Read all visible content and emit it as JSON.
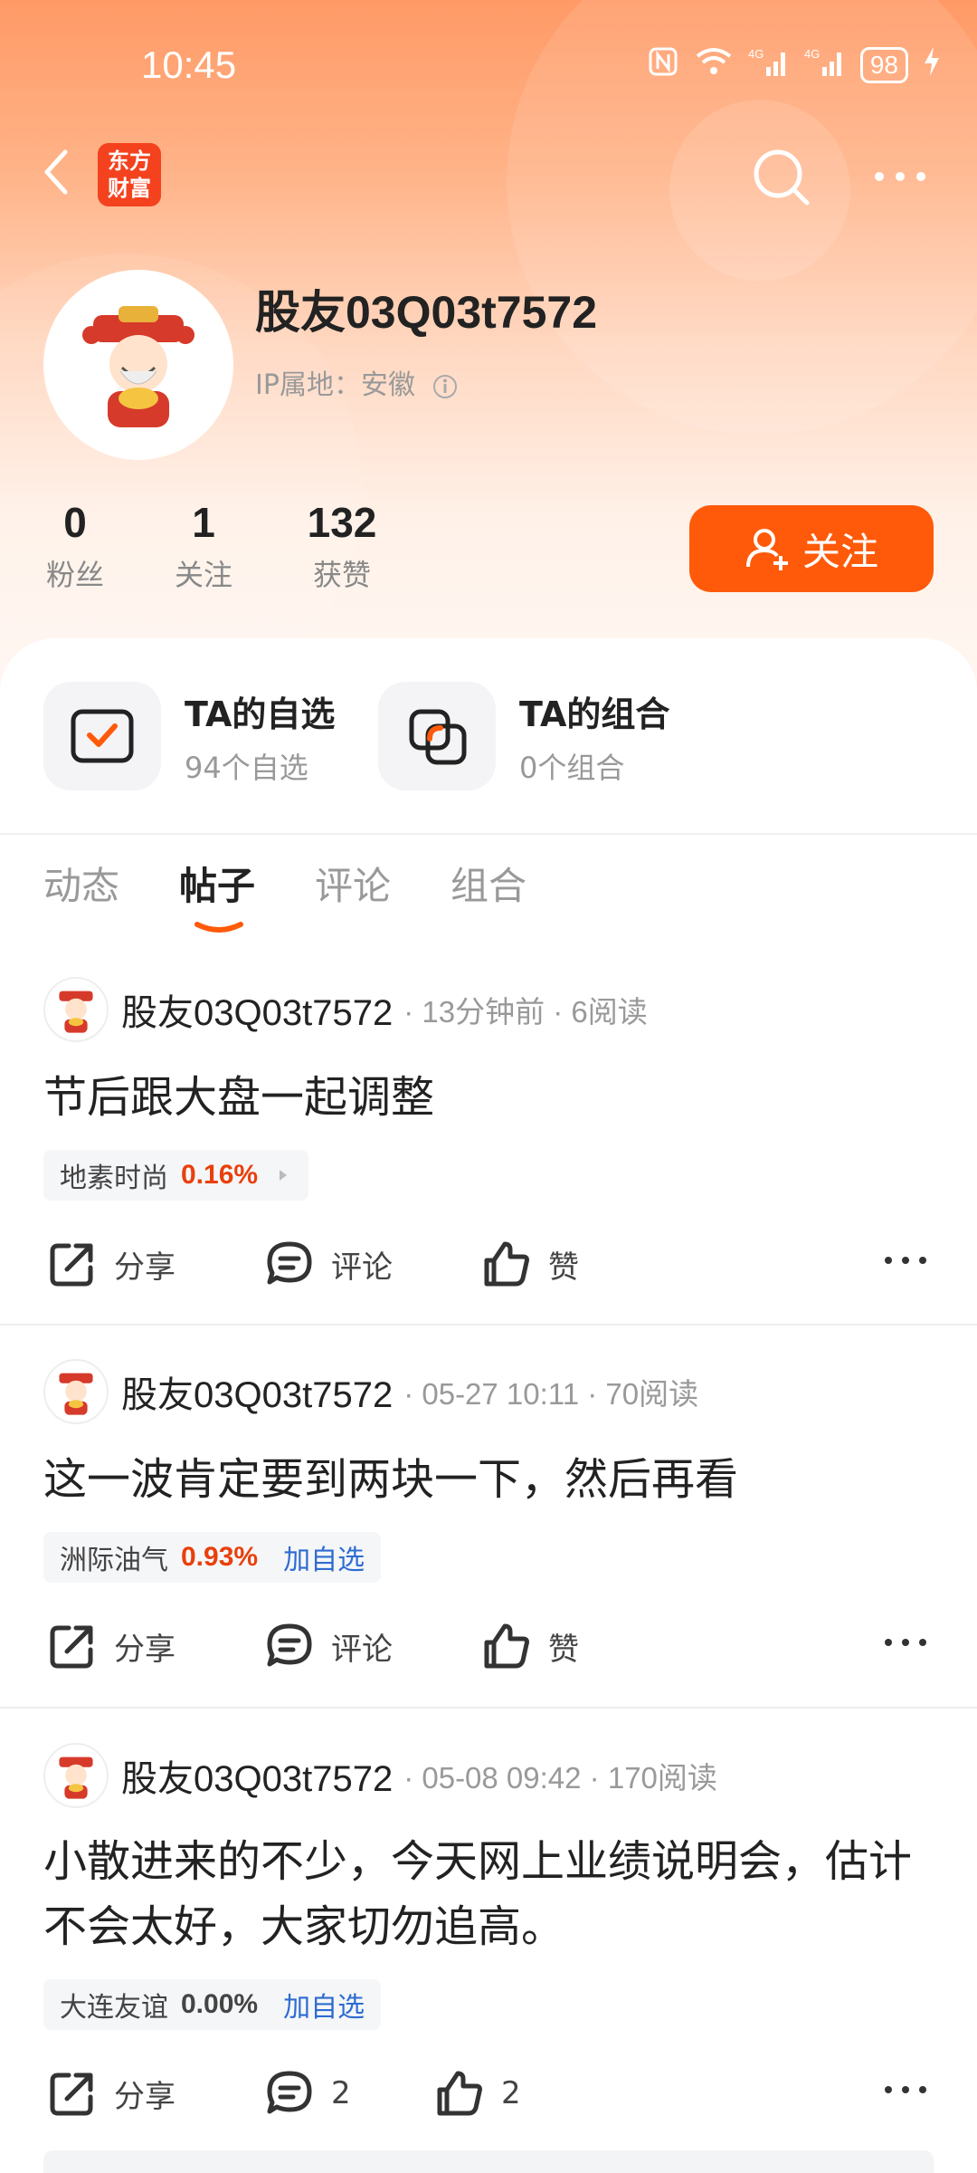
{
  "status_bar": {
    "time": "10:45",
    "network1": "4G",
    "network2": "4G",
    "battery": "98"
  },
  "top_nav": {
    "logo_line1": "东方",
    "logo_line2": "财富"
  },
  "profile": {
    "username": "股友03Q03t7572",
    "ip_label": "IP属地：",
    "ip_location": "安徽",
    "stats": [
      {
        "num": "0",
        "label": "粉丝"
      },
      {
        "num": "1",
        "label": "关注"
      },
      {
        "num": "132",
        "label": "获赞"
      }
    ],
    "follow_label": "关注"
  },
  "watch": [
    {
      "title": "TA的自选",
      "sub": "94个自选"
    },
    {
      "title": "TA的组合",
      "sub": "0个组合"
    }
  ],
  "tabs": [
    "动态",
    "帖子",
    "评论",
    "组合"
  ],
  "active_tab": "帖子",
  "posts": [
    {
      "name": "股友03Q03t7572",
      "meta": "· 13分钟前 · 6阅读",
      "body": "节后跟大盘一起调整",
      "stock": "地素时尚",
      "pct": "0.16%",
      "pct_color": "#e8400c",
      "add": "",
      "share": "分享",
      "comment": "评论",
      "like": "赞"
    },
    {
      "name": "股友03Q03t7572",
      "meta": "· 05-27 10:11 · 70阅读",
      "body": "这一波肯定要到两块一下，然后再看",
      "stock": "洲际油气",
      "pct": "0.93%",
      "pct_color": "#e8400c",
      "add": "加自选",
      "share": "分享",
      "comment": "评论",
      "like": "赞"
    },
    {
      "name": "股友03Q03t7572",
      "meta": "· 05-08 09:42 · 170阅读",
      "body": "小散进来的不少，今天网上业绩说明会，估计不会太好，大家切勿追高。",
      "stock": "大连友谊",
      "pct": "0.00%",
      "pct_color": "#444444",
      "add": "加自选",
      "share": "分享",
      "comment": "2",
      "like": "2"
    }
  ],
  "colors": {
    "accent": "#ff5a0a",
    "up": "#e8400c",
    "link": "#2e6cd1"
  }
}
